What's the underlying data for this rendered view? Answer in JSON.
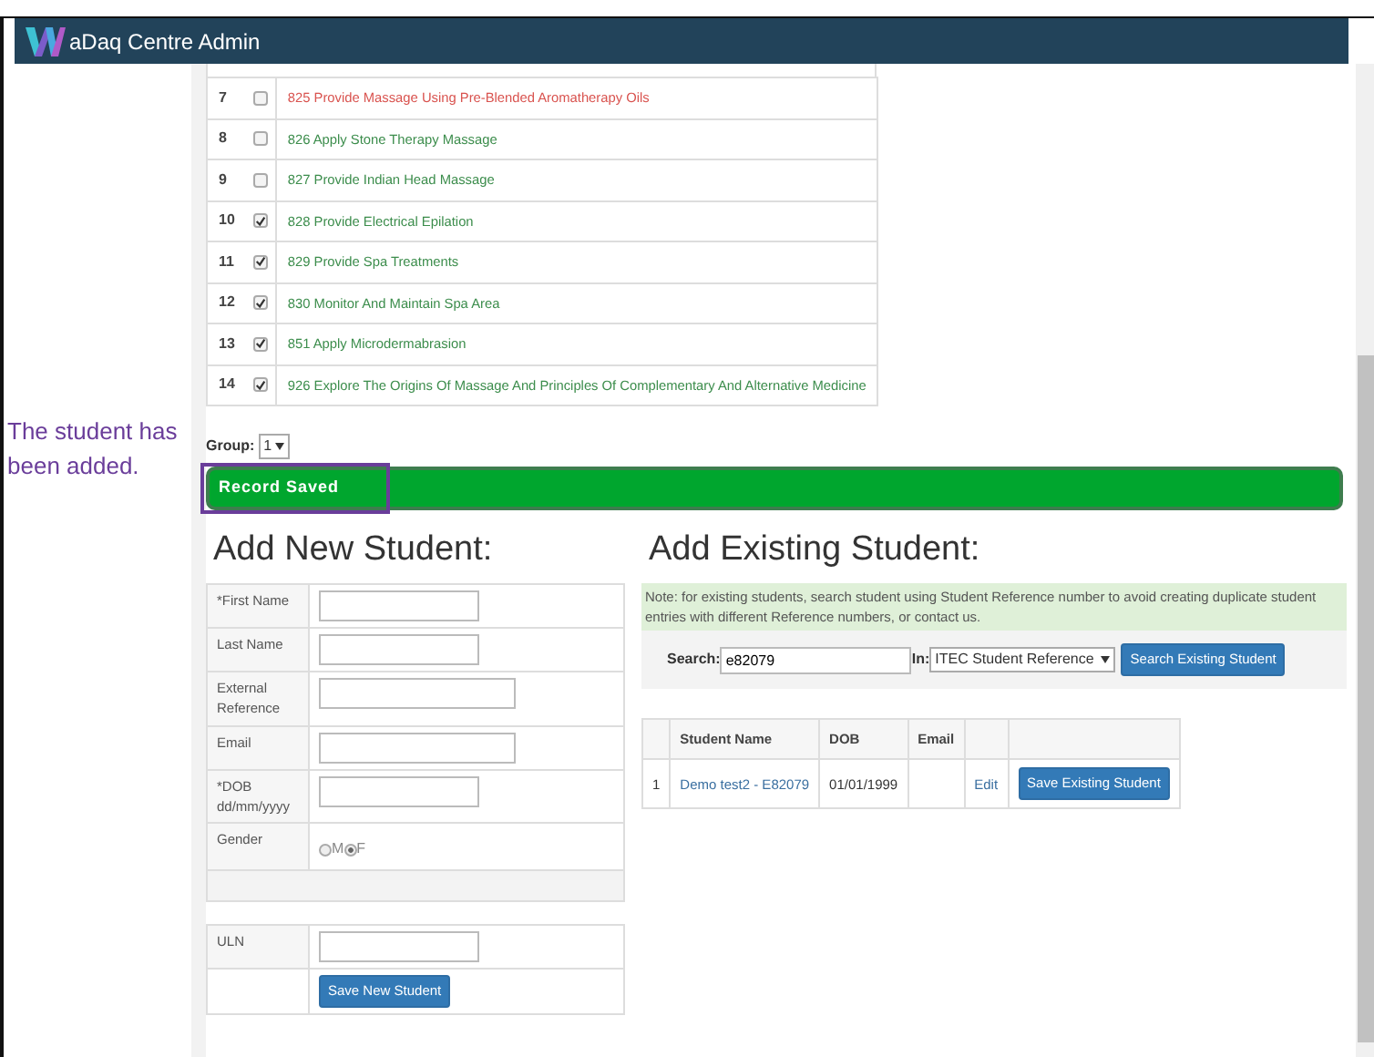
{
  "header": {
    "title": "aDaq Centre Admin"
  },
  "annotation": {
    "text": "The student has been added."
  },
  "units": [
    {
      "number": "7",
      "checked": false,
      "label": "825 Provide Massage Using Pre-Blended Aromatherapy Oils",
      "color": "#d9534f"
    },
    {
      "number": "8",
      "checked": false,
      "label": "826 Apply Stone Therapy Massage",
      "color": "#3c8d4c"
    },
    {
      "number": "9",
      "checked": false,
      "label": "827 Provide Indian Head Massage",
      "color": "#3c8d4c"
    },
    {
      "number": "10",
      "checked": true,
      "label": "828 Provide Electrical Epilation",
      "color": "#3c8d4c"
    },
    {
      "number": "11",
      "checked": true,
      "label": "829 Provide Spa Treatments",
      "color": "#3c8d4c"
    },
    {
      "number": "12",
      "checked": true,
      "label": "830 Monitor And Maintain Spa Area",
      "color": "#3c8d4c"
    },
    {
      "number": "13",
      "checked": true,
      "label": "851 Apply Microdermabrasion",
      "color": "#3c8d4c"
    },
    {
      "number": "14",
      "checked": true,
      "label": "926 Explore The Origins Of Massage And Principles Of Complementary And Alternative Medicine",
      "color": "#3c8d4c"
    }
  ],
  "group": {
    "label": "Group:",
    "value": "1"
  },
  "alert": {
    "text": "Record Saved"
  },
  "new_student": {
    "title": "Add New Student:",
    "fields": [
      {
        "label": "*First Name",
        "kind": "short"
      },
      {
        "label": "Last Name",
        "kind": "short"
      },
      {
        "label": "External Reference",
        "kind": "long"
      },
      {
        "label": "Email",
        "kind": "long"
      },
      {
        "label": "*DOB dd/mm/yyyy",
        "kind": "short"
      },
      {
        "label": "Gender",
        "kind": "radio",
        "options": [
          {
            "label": "M",
            "selected": false
          },
          {
            "label": "F",
            "selected": true
          }
        ]
      }
    ],
    "uln": {
      "label": "ULN"
    },
    "button": "Save New Student"
  },
  "existing_student": {
    "title": "Add Existing Student:",
    "note": "Note: for existing students, search student using Student Reference number to avoid creating duplicate student entries with different Reference numbers, or contact us.",
    "search": {
      "label": "Search:",
      "value": "e82079",
      "in_label": "In:",
      "select": "ITEC Student Reference",
      "button": "Search Existing Student"
    },
    "table": {
      "columns": [
        "Student Name",
        "DOB",
        "Email"
      ],
      "rows": [
        {
          "index": "1",
          "name": "Demo test2 - E82079",
          "dob": "01/01/1999",
          "edit": "Edit",
          "button": "Save Existing Student"
        }
      ]
    }
  }
}
